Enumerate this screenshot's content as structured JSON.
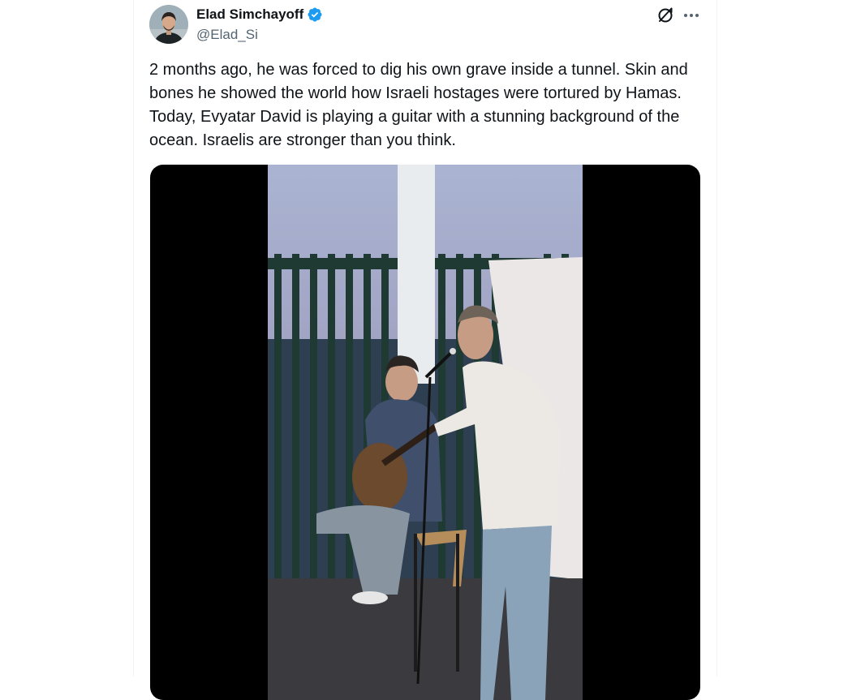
{
  "tweet": {
    "author_name": "Elad Simchayoff",
    "author_handle": "@Elad_Si",
    "verified": true,
    "text": "2 months ago, he was forced to dig his own grave inside a tunnel. Skin and bones he showed the world how Israeli hostages were tortured by Hamas. Today, Evyatar David is playing a guitar with a stunning background of the ocean. Israelis are stronger than you think.",
    "media": {
      "type": "video"
    }
  },
  "icons": {
    "verified": "verified-badge-icon",
    "grok": "grok-icon",
    "more": "more-options-icon"
  },
  "colors": {
    "text_primary": "#0f1419",
    "text_secondary": "#536471",
    "verified_blue": "#1d9bf0",
    "border": "#eff3f4"
  }
}
